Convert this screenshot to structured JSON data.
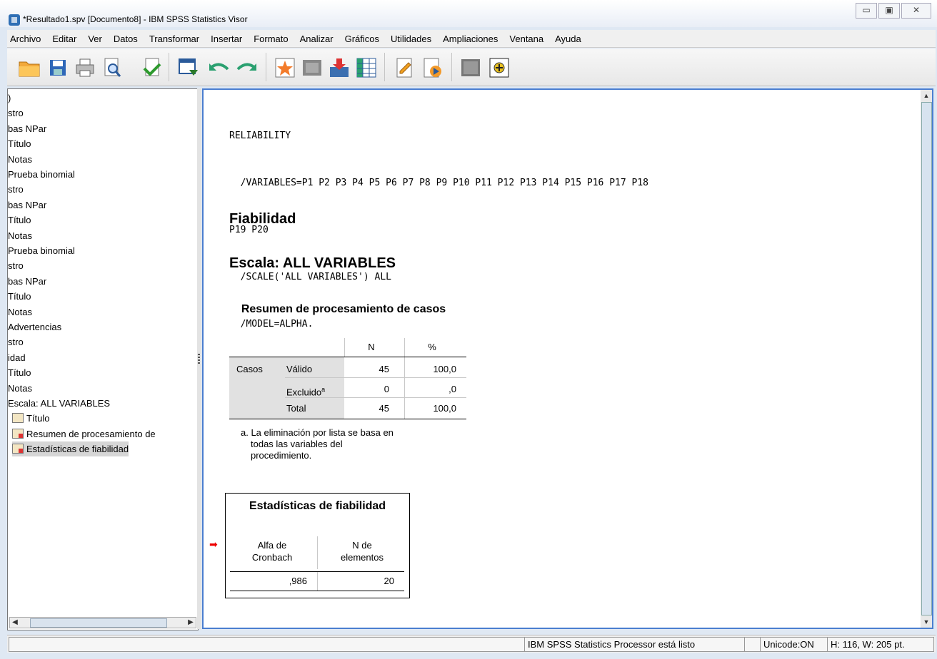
{
  "window": {
    "title": "*Resultado1.spv [Documento8] - IBM SPSS Statistics Visor",
    "buttons": [
      "▭",
      "▣",
      "✕"
    ]
  },
  "menu": [
    "Archivo",
    "Editar",
    "Ver",
    "Datos",
    "Transformar",
    "Insertar",
    "Formato",
    "Analizar",
    "Gráficos",
    "Utilidades",
    "Ampliaciones",
    "Ventana",
    "Ayuda"
  ],
  "toolbar": {
    "icons": [
      "open-icon",
      "save-icon",
      "print-icon",
      "print-preview-icon",
      "export-icon",
      "goto-data-icon",
      "undo-icon",
      "redo-icon",
      "designate-window-icon",
      "select-last-output-icon",
      "insert-heading-icon",
      "insert-table-icon",
      "insert-text-icon",
      "run-script-icon",
      "collapse-icon",
      "expand-icon"
    ]
  },
  "tree": {
    "items": [
      {
        "label": ")",
        "indent": 0
      },
      {
        "label": "stro",
        "indent": 0
      },
      {
        "label": "bas NPar",
        "indent": 0
      },
      {
        "label": "Título",
        "indent": 0
      },
      {
        "label": "Notas",
        "indent": 0
      },
      {
        "label": "Prueba binomial",
        "indent": 0
      },
      {
        "label": "stro",
        "indent": 0
      },
      {
        "label": "bas NPar",
        "indent": 0
      },
      {
        "label": "Título",
        "indent": 0
      },
      {
        "label": "Notas",
        "indent": 0
      },
      {
        "label": "Prueba binomial",
        "indent": 0
      },
      {
        "label": "stro",
        "indent": 0
      },
      {
        "label": "bas NPar",
        "indent": 0
      },
      {
        "label": "Título",
        "indent": 0
      },
      {
        "label": "Notas",
        "indent": 0
      },
      {
        "label": "Advertencias",
        "indent": 0
      },
      {
        "label": "stro",
        "indent": 0
      },
      {
        "label": "idad",
        "indent": 0
      },
      {
        "label": "Título",
        "indent": 0
      },
      {
        "label": "Notas",
        "indent": 0
      },
      {
        "label": "Escala: ALL VARIABLES",
        "indent": 0
      },
      {
        "label": "Título",
        "indent": 1,
        "icon": "title-icon"
      },
      {
        "label": "Resumen de procesamiento de",
        "indent": 1,
        "icon": "table-icon"
      },
      {
        "label": "Estadísticas de fiabilidad",
        "indent": 1,
        "icon": "table-icon",
        "selected": true
      }
    ]
  },
  "output": {
    "syntax": [
      "RELIABILITY",
      "  /VARIABLES=P1 P2 P3 P4 P5 P6 P7 P8 P9 P10 P11 P12 P13 P14 P15 P16 P17 P18",
      "P19 P20",
      "  /SCALE('ALL VARIABLES') ALL",
      "  /MODEL=ALPHA."
    ],
    "heading1": "Fiabilidad",
    "heading2": "Escala: ALL VARIABLES",
    "case_table": {
      "title": "Resumen de procesamiento de casos",
      "col_n": "N",
      "col_pct": "%",
      "row_group": "Casos",
      "rows": [
        {
          "label": "Válido",
          "n": "45",
          "pct": "100,0"
        },
        {
          "label": "Excluido",
          "sup": "a",
          "n": "0",
          "pct": ",0"
        },
        {
          "label": "Total",
          "n": "45",
          "pct": "100,0"
        }
      ],
      "footnote": [
        "a. La eliminación por lista se basa en",
        "todas las variables del",
        "procedimiento."
      ]
    },
    "reliability_table": {
      "title": "Estadísticas de fiabilidad",
      "col1": [
        "Alfa de",
        "Cronbach"
      ],
      "col2": [
        "N de",
        "elementos"
      ],
      "alpha": ",986",
      "n_items": "20"
    }
  },
  "status": {
    "processor": "IBM SPSS Statistics Processor está listo",
    "unicode": "Unicode:ON",
    "dims": "H: 116, W: 205 pt."
  }
}
